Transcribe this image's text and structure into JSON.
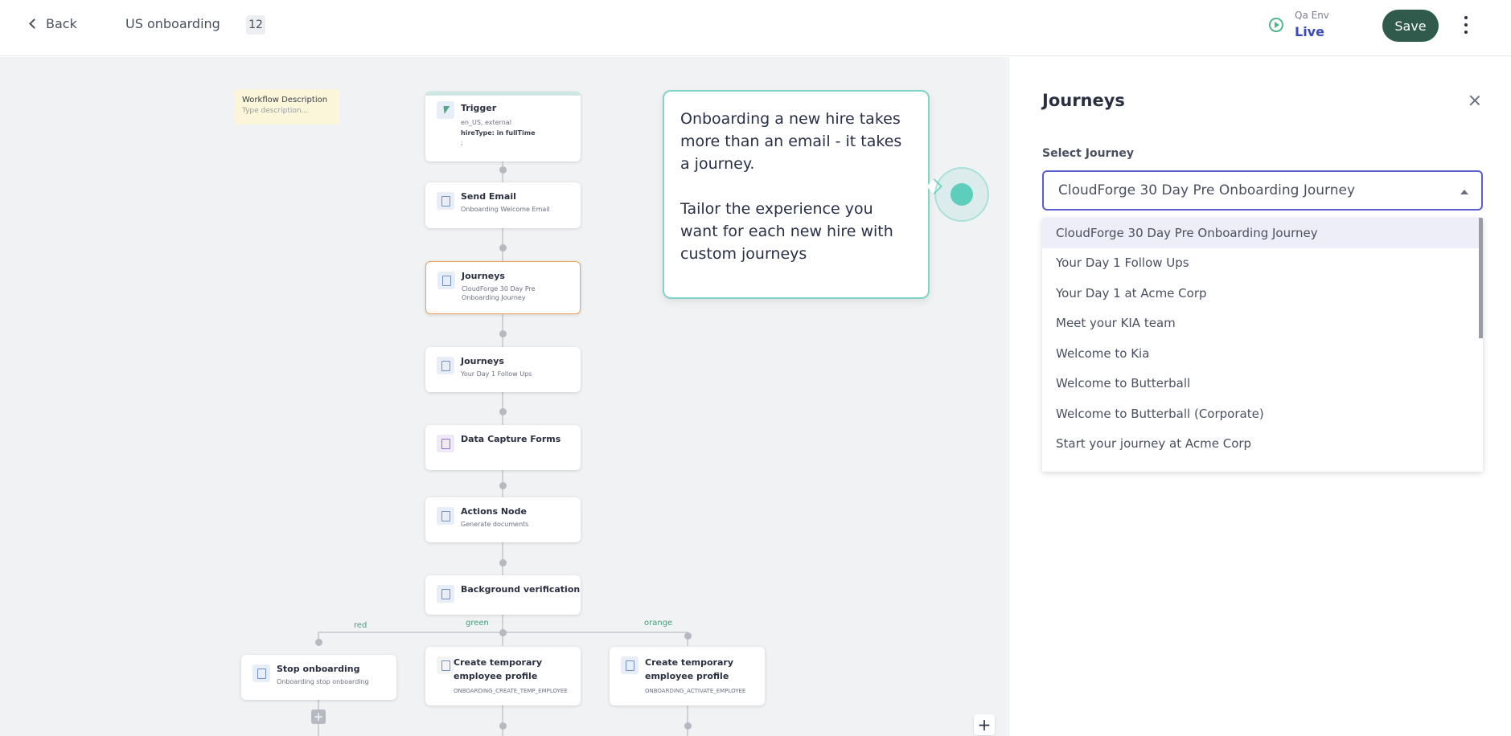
{
  "header": {
    "back_label": "Back",
    "workflow_title": "US onboarding",
    "workflow_count": "12",
    "env_name": "Qa Env",
    "env_status": "Live",
    "save_label": "Save"
  },
  "canvas": {
    "note": {
      "title": "Workflow Description",
      "placeholder": "Type description..."
    },
    "nodes": [
      {
        "title": "Trigger",
        "lines": [
          "en_US, external",
          "hireType: in fullTime",
          ";"
        ]
      },
      {
        "title": "Send Email",
        "subtitle": "Onboarding Welcome Email"
      },
      {
        "title": "Journeys",
        "subtitle": "CloudForge 30 Day Pre Onboarding Journey"
      },
      {
        "title": "Journeys",
        "subtitle": "Your Day 1 Follow Ups"
      },
      {
        "title": "Data Capture Forms",
        "subtitle": ""
      },
      {
        "title": "Actions Node",
        "subtitle": "Generate documents"
      },
      {
        "title": "Background verification",
        "subtitle": ""
      },
      {
        "title": "Stop onboarding",
        "subtitle": "Onboarding stop onboarding"
      },
      {
        "title": "Create temporary employee profile",
        "subtitle": "ONBOARDING_CREATE_TEMP_EMPLOYEE"
      },
      {
        "title": "Create temporary employee profile",
        "subtitle": "ONBOARDING_ACTIVATE_EMPLOYEE"
      }
    ],
    "branches": {
      "red": "red",
      "green": "green",
      "orange": "orange"
    }
  },
  "tooltip": {
    "p1": "Onboarding a new hire takes more than an email -  it takes a journey.",
    "p2": "Tailor the experience you want for each new hire with custom journeys"
  },
  "panel": {
    "title": "Journeys",
    "select_label": "Select Journey",
    "selected": "CloudForge 30 Day Pre Onboarding Journey",
    "options": [
      "CloudForge 30 Day Pre Onboarding Journey",
      "Your Day 1 Follow Ups",
      "Your Day 1 at Acme Corp",
      "Meet your KIA team",
      "Welcome to Kia",
      "Welcome to Butterball",
      "Welcome to Butterball (Corporate)",
      "Start your journey at Acme Corp"
    ]
  }
}
